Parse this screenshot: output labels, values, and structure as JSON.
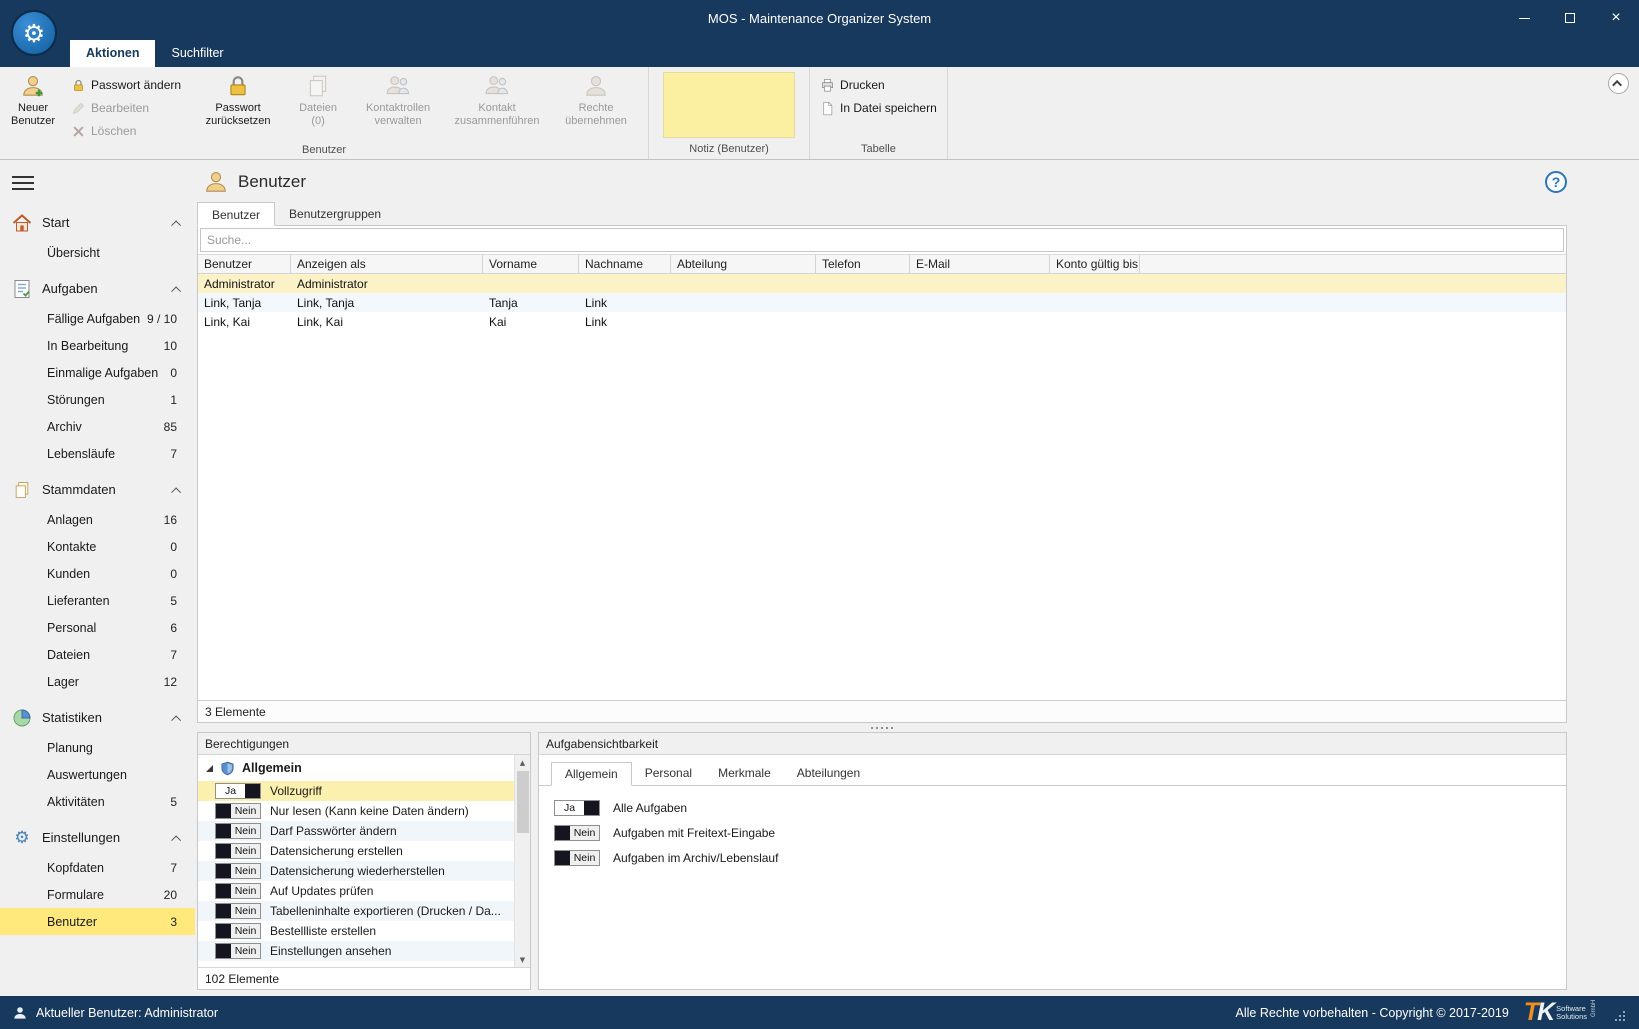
{
  "window": {
    "title": "MOS - Maintenance Organizer System"
  },
  "icons": {
    "gear": "⚙",
    "help": "?",
    "arrow_up": "▲",
    "arrow_down": "▼",
    "close": "×"
  },
  "ribbon": {
    "tabs": [
      {
        "label": "Aktionen"
      },
      {
        "label": "Suchfilter"
      }
    ],
    "buttons": {
      "new_user": "Neuer Benutzer",
      "change_password": "Passwort ändern",
      "edit": "Bearbeiten",
      "delete": "Löschen",
      "reset_password": "Passwort zurücksetzen",
      "files": "Dateien (0)",
      "contact_roles": "Kontaktrollen verwalten",
      "merge_contact": "Kontakt zusammenführen",
      "adopt_rights": "Rechte übernehmen",
      "print": "Drucken",
      "save_to_file": "In Datei speichern"
    },
    "groups": {
      "benutzer": "Benutzer",
      "notiz": "Notiz (Benutzer)",
      "tabelle": "Tabelle"
    }
  },
  "sidebar": {
    "sections": [
      {
        "label": "Start",
        "items": [
          {
            "label": "Übersicht",
            "count": ""
          }
        ]
      },
      {
        "label": "Aufgaben",
        "items": [
          {
            "label": "Fällige Aufgaben",
            "count": "9 / 10"
          },
          {
            "label": "In Bearbeitung",
            "count": "10"
          },
          {
            "label": "Einmalige Aufgaben",
            "count": "0"
          },
          {
            "label": "Störungen",
            "count": "1"
          },
          {
            "label": "Archiv",
            "count": "85"
          },
          {
            "label": "Lebensläufe",
            "count": "7"
          }
        ]
      },
      {
        "label": "Stammdaten",
        "items": [
          {
            "label": "Anlagen",
            "count": "16"
          },
          {
            "label": "Kontakte",
            "count": "0"
          },
          {
            "label": "Kunden",
            "count": "0"
          },
          {
            "label": "Lieferanten",
            "count": "5"
          },
          {
            "label": "Personal",
            "count": "6"
          },
          {
            "label": "Dateien",
            "count": "7"
          },
          {
            "label": "Lager",
            "count": "12"
          }
        ]
      },
      {
        "label": "Statistiken",
        "items": [
          {
            "label": "Planung",
            "count": ""
          },
          {
            "label": "Auswertungen",
            "count": ""
          },
          {
            "label": "Aktivitäten",
            "count": "5"
          }
        ]
      },
      {
        "label": "Einstellungen",
        "items": [
          {
            "label": "Kopfdaten",
            "count": "7"
          },
          {
            "label": "Formulare",
            "count": "20"
          },
          {
            "label": "Benutzer",
            "count": "3"
          }
        ]
      }
    ]
  },
  "content": {
    "title": "Benutzer",
    "tabs": [
      "Benutzer",
      "Benutzergruppen"
    ],
    "search_placeholder": "Suche...",
    "table": {
      "columns": [
        "Benutzer",
        "Anzeigen als",
        "Vorname",
        "Nachname",
        "Abteilung",
        "Telefon",
        "E-Mail",
        "Konto gültig bis"
      ],
      "rows": [
        [
          "Administrator",
          "Administrator",
          "",
          "",
          "",
          "",
          "",
          ""
        ],
        [
          "Link, Tanja",
          "Link, Tanja",
          "Tanja",
          "Link",
          "",
          "",
          "",
          ""
        ],
        [
          "Link, Kai",
          "Link, Kai",
          "Kai",
          "Link",
          "",
          "",
          "",
          ""
        ]
      ],
      "count": "3 Elemente"
    }
  },
  "permissions": {
    "title": "Berechtigungen",
    "group": "Allgemein",
    "items": [
      {
        "value": "Ja",
        "label": "Vollzugriff"
      },
      {
        "value": "Nein",
        "label": "Nur lesen (Kann keine Daten ändern)"
      },
      {
        "value": "Nein",
        "label": "Darf Passwörter ändern"
      },
      {
        "value": "Nein",
        "label": "Datensicherung erstellen"
      },
      {
        "value": "Nein",
        "label": "Datensicherung wiederherstellen"
      },
      {
        "value": "Nein",
        "label": "Auf Updates prüfen"
      },
      {
        "value": "Nein",
        "label": "Tabelleninhalte exportieren (Drucken / Da..."
      },
      {
        "value": "Nein",
        "label": "Bestellliste erstellen"
      },
      {
        "value": "Nein",
        "label": "Einstellungen ansehen"
      }
    ],
    "count": "102 Elemente"
  },
  "visibility": {
    "title": "Aufgabensichtbarkeit",
    "tabs": [
      "Allgemein",
      "Personal",
      "Merkmale",
      "Abteilungen"
    ],
    "items": [
      {
        "value": "Ja",
        "label": "Alle Aufgaben"
      },
      {
        "value": "Nein",
        "label": "Aufgaben mit Freitext-Eingabe"
      },
      {
        "value": "Nein",
        "label": "Aufgaben im Archiv/Lebenslauf"
      }
    ]
  },
  "statusbar": {
    "current_user": "Aktueller Benutzer: Administrator",
    "copyright": "Alle Rechte vorbehalten - Copyright © 2017-2019",
    "logo": {
      "t": "T",
      "k": "K",
      "line1": "Software",
      "line2": "Solutions",
      "gmbh": "GmbH"
    }
  }
}
